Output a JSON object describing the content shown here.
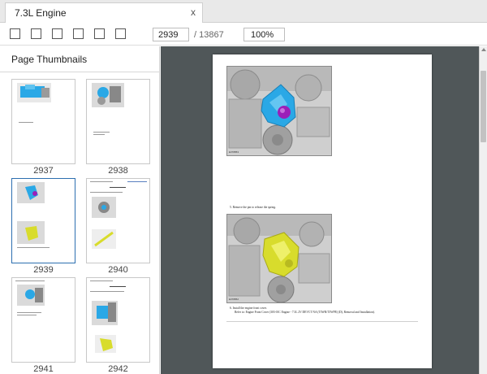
{
  "tab": {
    "title": "7.3L Engine",
    "close": "x"
  },
  "toolbar": {
    "buttons": [
      "sidebar-toggle",
      "previous-page",
      "next-page",
      "zoom-out",
      "zoom-in",
      "fit-page"
    ],
    "current_page": "2939",
    "total_pages": "/ 13867",
    "zoom": "100%"
  },
  "sidebar": {
    "title": "Page Thumbnails",
    "thumbnails": [
      {
        "page": "2937",
        "selected": false
      },
      {
        "page": "2938",
        "selected": false
      },
      {
        "page": "2939",
        "selected": true
      },
      {
        "page": "2940",
        "selected": false
      },
      {
        "page": "2941",
        "selected": false
      },
      {
        "page": "2942",
        "selected": false
      }
    ]
  },
  "document": {
    "step5": "5.  Remove the pin to release the spring.",
    "step6_title": "6.  Install the engine front cover.",
    "step6_ref": "Refer to: Engine Front Cover (303-01C Engine - 7.3L 2V DEVCT NA (T3WR/T3WPE) (D), Removal and Installation).",
    "figure1_id": "E378853",
    "figure2_id": "E378852"
  },
  "colors": {
    "accent_blue": "#2aa8e6",
    "accent_purple": "#9b1fb8",
    "accent_yellow": "#d8dc2c",
    "viewer_bg": "#505759"
  }
}
